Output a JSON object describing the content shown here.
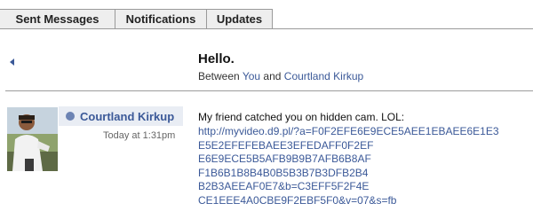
{
  "tabs": [
    {
      "label": "Sent Messages"
    },
    {
      "label": "Notifications"
    },
    {
      "label": "Updates"
    }
  ],
  "thread": {
    "title": "Hello.",
    "between_prefix": "Between",
    "participant_you": "You",
    "conjunction": "and",
    "participant_other": "Courtland Kirkup"
  },
  "message": {
    "author": "Courtland Kirkup",
    "timestamp": "Today at 1:31pm",
    "text": "My friend catched you on hidden cam. LOL:",
    "link_lines": [
      "http://myvideo.d9.pl/?a=F0F2EFE6E9ECE5AEE1EBAEE6E1E3",
      "E5E2EFEFEBAEE3EFEDAFF0F2EF",
      "E6E9ECE5B5AFB9B9B7AFB6B8AF",
      "F1B6B1B8B4B0B5B3B7B3DFB2B4",
      "B2B3AEEAF0E7&b=C3EFF5F2F4E",
      "CE1EEE4A0CBE9F2EBF5F0&v=07&s=fb"
    ]
  },
  "colors": {
    "link": "#3b5998",
    "tab_bg": "#eeeeee",
    "author_bg": "#e9edf4"
  },
  "icons": {
    "back": "left-triangle",
    "presence": "filled-circle"
  }
}
